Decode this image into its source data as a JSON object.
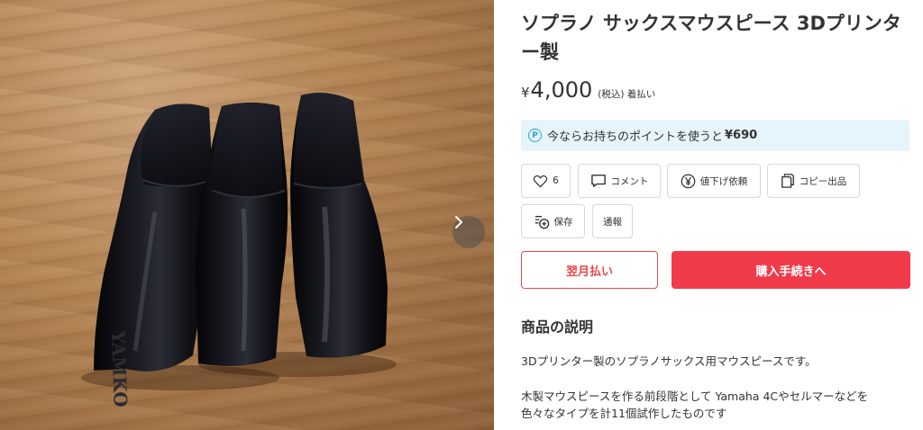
{
  "product": {
    "title": "ソプラノ サックスマウスピース 3Dプリンター製",
    "price_currency": "¥",
    "price_value": "4,000",
    "price_note": "(税込) 着払い"
  },
  "points": {
    "icon": "point-p-icon",
    "icon_glyph": "P",
    "text": "今ならお持ちのポイントを使うと",
    "amount": "¥690",
    "background": "#e5f5fb"
  },
  "actions": {
    "like_count": "6",
    "comment_label": "コメント",
    "discount_label": "値下げ依頼",
    "copy_label": "コピー出品",
    "save_label": "保存",
    "report_label": "通報"
  },
  "buttons": {
    "pay_later_label": "翌月払い",
    "buy_label": "購入手続きへ",
    "accent_color": "#f13a4a"
  },
  "description": {
    "heading": "商品の説明",
    "line1": "3Dプリンター製のソプラノサックス用マウスピースです。",
    "line2": "木製マウスピースを作る前段階として Yamaha 4Cやセルマーなどを",
    "line3": "色々なタイプを計11個試作したものです"
  },
  "photo": {
    "subject": "three black 3D-printed soprano saxophone mouthpieces on wooden table",
    "embossed_text": "YAMKO",
    "next_icon": "chevron-right-icon"
  }
}
